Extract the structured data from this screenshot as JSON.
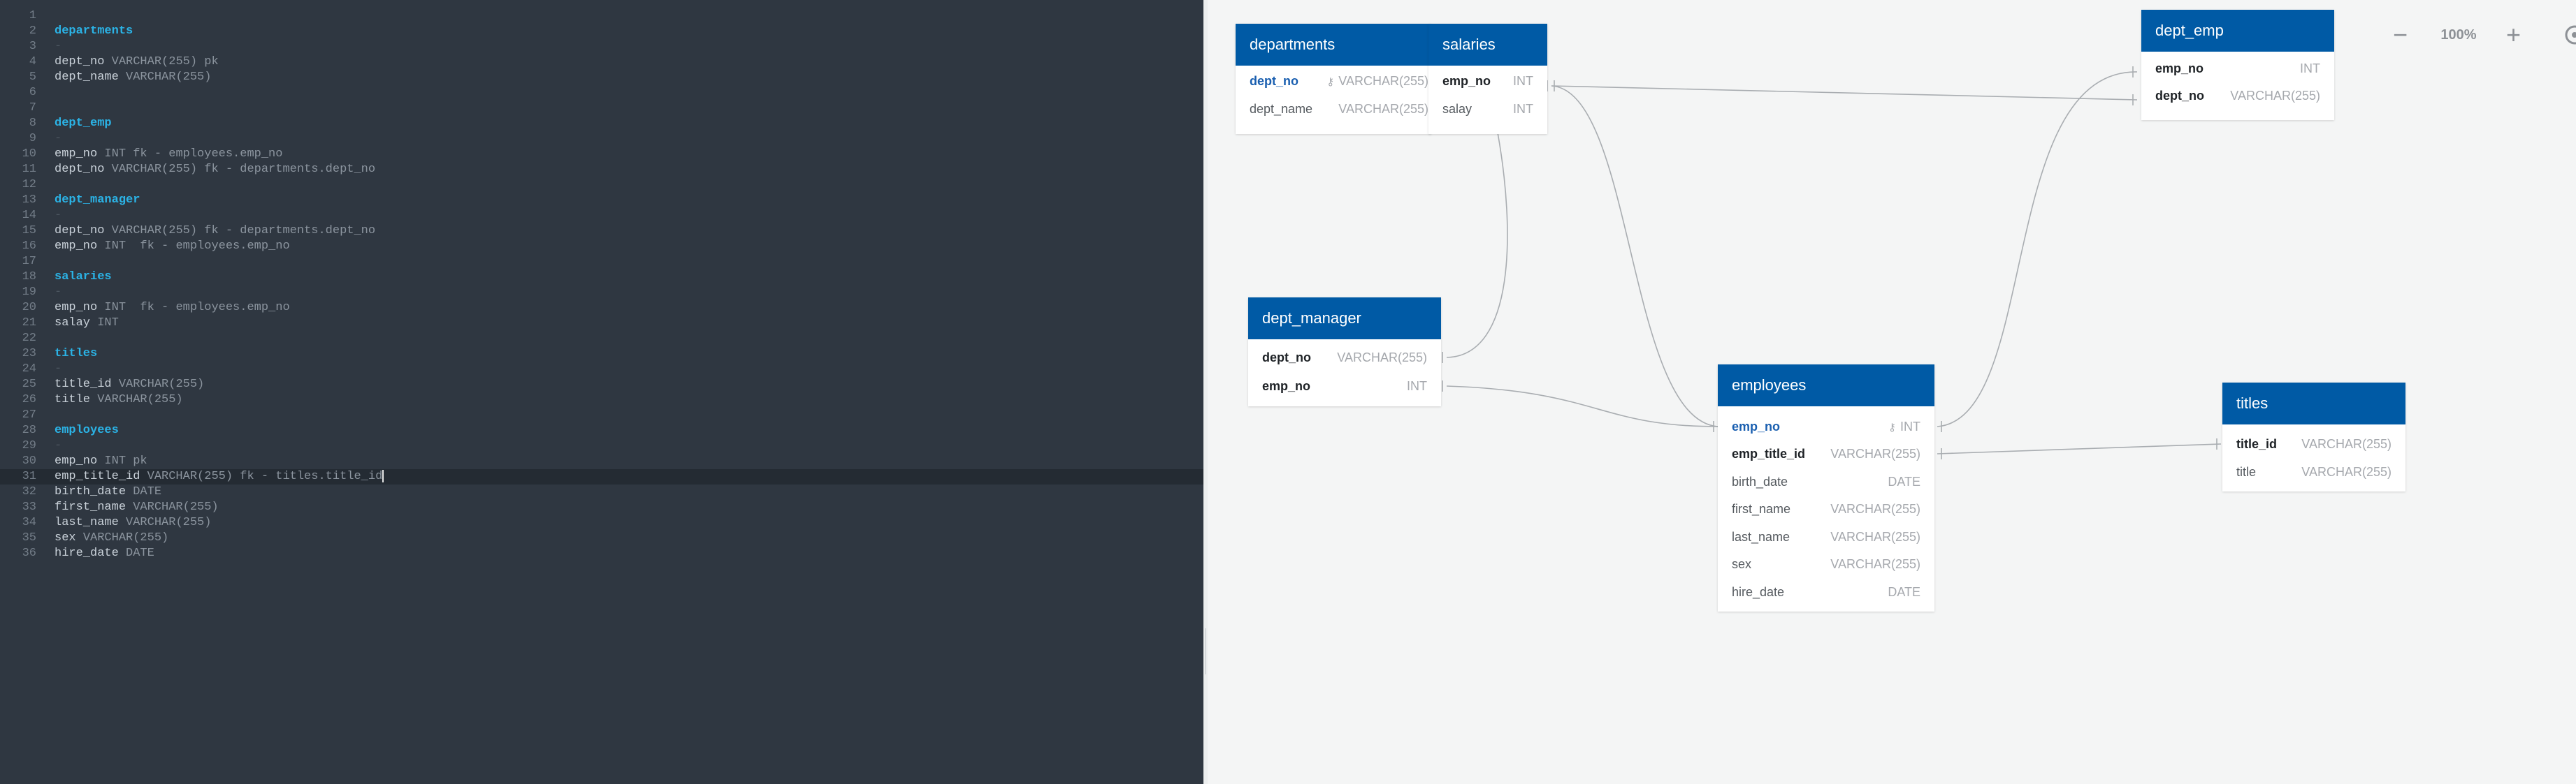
{
  "editor": {
    "lines": [
      {
        "n": "1",
        "parts": []
      },
      {
        "n": "2",
        "parts": [
          {
            "c": "heading",
            "t": "departments"
          }
        ]
      },
      {
        "n": "3",
        "parts": [
          {
            "c": "dash",
            "t": "-"
          }
        ]
      },
      {
        "n": "4",
        "parts": [
          {
            "c": "",
            "t": "dept_no "
          },
          {
            "c": "type",
            "t": "VARCHAR(255) pk"
          }
        ]
      },
      {
        "n": "5",
        "parts": [
          {
            "c": "",
            "t": "dept_name "
          },
          {
            "c": "type",
            "t": "VARCHAR(255)"
          }
        ]
      },
      {
        "n": "6",
        "parts": []
      },
      {
        "n": "7",
        "parts": []
      },
      {
        "n": "8",
        "parts": [
          {
            "c": "heading",
            "t": "dept_emp"
          }
        ]
      },
      {
        "n": "9",
        "parts": [
          {
            "c": "dash",
            "t": "-"
          }
        ]
      },
      {
        "n": "10",
        "parts": [
          {
            "c": "",
            "t": "emp_no "
          },
          {
            "c": "type",
            "t": "INT fk - employees.emp_no"
          }
        ]
      },
      {
        "n": "11",
        "parts": [
          {
            "c": "",
            "t": "dept_no "
          },
          {
            "c": "type",
            "t": "VARCHAR(255) fk - departments.dept_no"
          }
        ]
      },
      {
        "n": "12",
        "parts": []
      },
      {
        "n": "13",
        "parts": [
          {
            "c": "heading",
            "t": "dept_manager"
          }
        ]
      },
      {
        "n": "14",
        "parts": [
          {
            "c": "dash",
            "t": "-"
          }
        ]
      },
      {
        "n": "15",
        "parts": [
          {
            "c": "",
            "t": "dept_no "
          },
          {
            "c": "type",
            "t": "VARCHAR(255) fk - departments.dept_no"
          }
        ]
      },
      {
        "n": "16",
        "parts": [
          {
            "c": "",
            "t": "emp_no "
          },
          {
            "c": "type",
            "t": "INT  fk - employees.emp_no"
          }
        ]
      },
      {
        "n": "17",
        "parts": []
      },
      {
        "n": "18",
        "parts": [
          {
            "c": "heading",
            "t": "salaries"
          }
        ]
      },
      {
        "n": "19",
        "parts": [
          {
            "c": "dash",
            "t": "-"
          }
        ]
      },
      {
        "n": "20",
        "parts": [
          {
            "c": "",
            "t": "emp_no "
          },
          {
            "c": "type",
            "t": "INT  fk - employees.emp_no"
          }
        ]
      },
      {
        "n": "21",
        "parts": [
          {
            "c": "",
            "t": "salay "
          },
          {
            "c": "type",
            "t": "INT"
          }
        ]
      },
      {
        "n": "22",
        "parts": []
      },
      {
        "n": "23",
        "parts": [
          {
            "c": "heading",
            "t": "titles"
          }
        ]
      },
      {
        "n": "24",
        "parts": [
          {
            "c": "dash",
            "t": "-"
          }
        ]
      },
      {
        "n": "25",
        "parts": [
          {
            "c": "",
            "t": "title_id "
          },
          {
            "c": "type",
            "t": "VARCHAR(255)"
          }
        ]
      },
      {
        "n": "26",
        "parts": [
          {
            "c": "",
            "t": "title "
          },
          {
            "c": "type",
            "t": "VARCHAR(255)"
          }
        ]
      },
      {
        "n": "27",
        "parts": []
      },
      {
        "n": "28",
        "parts": [
          {
            "c": "heading",
            "t": "employees"
          }
        ]
      },
      {
        "n": "29",
        "parts": [
          {
            "c": "dash",
            "t": "-"
          }
        ]
      },
      {
        "n": "30",
        "parts": [
          {
            "c": "",
            "t": "emp_no "
          },
          {
            "c": "type",
            "t": "INT pk"
          }
        ]
      },
      {
        "n": "31",
        "parts": [
          {
            "c": "",
            "t": "emp_title_id "
          },
          {
            "c": "type",
            "t": "VARCHAR(255) fk - titles.title_id"
          }
        ],
        "active": true
      },
      {
        "n": "32",
        "parts": [
          {
            "c": "",
            "t": "birth_date "
          },
          {
            "c": "type",
            "t": "DATE"
          }
        ]
      },
      {
        "n": "33",
        "parts": [
          {
            "c": "",
            "t": "first_name "
          },
          {
            "c": "type",
            "t": "VARCHAR(255)"
          }
        ]
      },
      {
        "n": "34",
        "parts": [
          {
            "c": "",
            "t": "last_name "
          },
          {
            "c": "type",
            "t": "VARCHAR(255)"
          }
        ]
      },
      {
        "n": "35",
        "parts": [
          {
            "c": "",
            "t": "sex "
          },
          {
            "c": "type",
            "t": "VARCHAR(255)"
          }
        ]
      },
      {
        "n": "36",
        "parts": [
          {
            "c": "",
            "t": "hire_date "
          },
          {
            "c": "type",
            "t": "DATE"
          }
        ]
      }
    ]
  },
  "diagram": {
    "tables": {
      "departments": {
        "title": "departments",
        "rows": [
          {
            "name": "dept_no",
            "type": "VARCHAR(255)",
            "pk": true
          },
          {
            "name": "dept_name",
            "type": "VARCHAR(255)"
          }
        ]
      },
      "salaries": {
        "title": "salaries",
        "rows": [
          {
            "name": "emp_no",
            "type": "INT",
            "fk": true
          },
          {
            "name": "salay",
            "type": "INT"
          }
        ]
      },
      "dept_emp": {
        "title": "dept_emp",
        "rows": [
          {
            "name": "emp_no",
            "type": "INT",
            "fk": true
          },
          {
            "name": "dept_no",
            "type": "VARCHAR(255)",
            "fk": true
          }
        ]
      },
      "dept_manager": {
        "title": "dept_manager",
        "rows": [
          {
            "name": "dept_no",
            "type": "VARCHAR(255)",
            "fk": true
          },
          {
            "name": "emp_no",
            "type": "INT",
            "fk": true
          }
        ]
      },
      "employees": {
        "title": "employees",
        "rows": [
          {
            "name": "emp_no",
            "type": "INT",
            "pk": true
          },
          {
            "name": "emp_title_id",
            "type": "VARCHAR(255)",
            "fk": true
          },
          {
            "name": "birth_date",
            "type": "DATE"
          },
          {
            "name": "first_name",
            "type": "VARCHAR(255)"
          },
          {
            "name": "last_name",
            "type": "VARCHAR(255)"
          },
          {
            "name": "sex",
            "type": "VARCHAR(255)"
          },
          {
            "name": "hire_date",
            "type": "DATE"
          }
        ]
      },
      "titles": {
        "title": "titles",
        "rows": [
          {
            "name": "title_id",
            "type": "VARCHAR(255)",
            "fk": true
          },
          {
            "name": "title",
            "type": "VARCHAR(255)"
          }
        ]
      }
    }
  },
  "zoom": {
    "level": "100%",
    "minus": "−",
    "plus": "+"
  },
  "colors": {
    "header": "#005aa5",
    "editor_bg": "#2f3741",
    "heading": "#2bb3e6",
    "connector": "#a9adb1"
  }
}
